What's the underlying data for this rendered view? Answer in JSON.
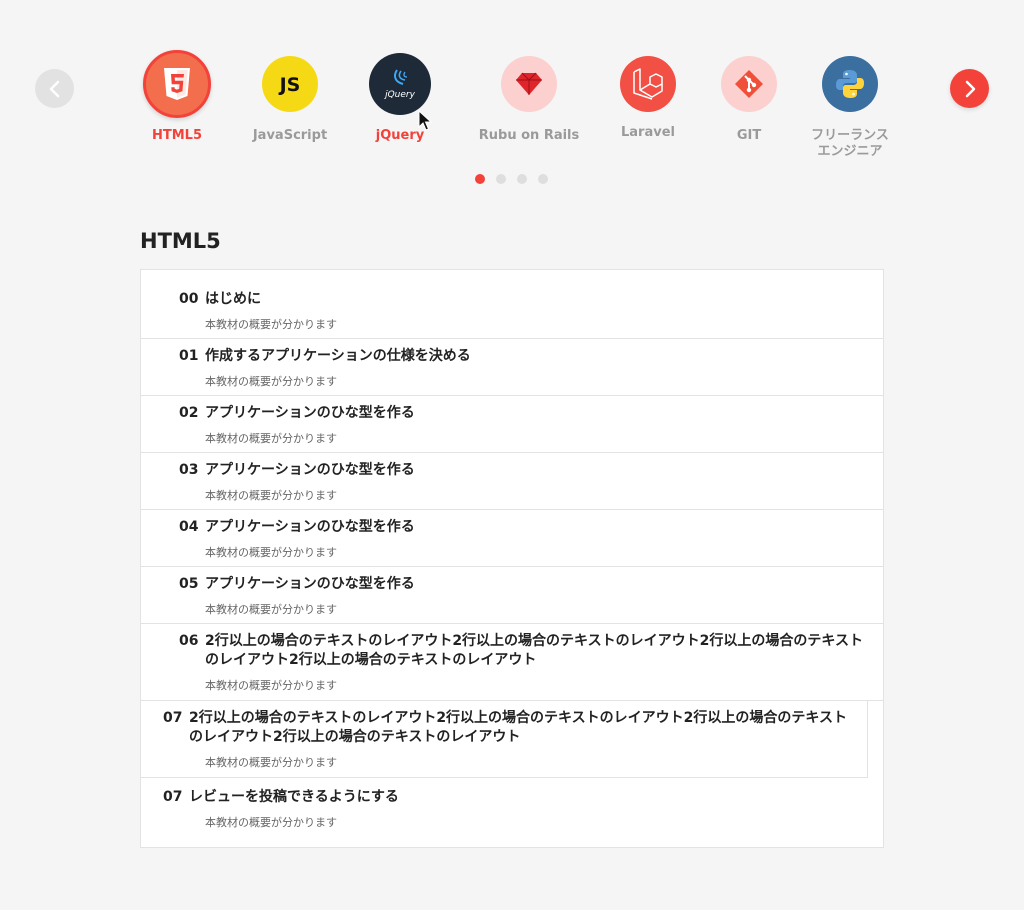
{
  "carousel": {
    "categories": [
      {
        "label": "HTML5",
        "icon": "html5-icon",
        "color": "#f26e4d"
      },
      {
        "label": "JavaScript",
        "icon": "js-icon",
        "color": "#f6d915"
      },
      {
        "label": "jQuery",
        "icon": "jquery-icon",
        "color": "#1e2a38"
      },
      {
        "label": "Rubu on Rails",
        "icon": "ruby-icon",
        "color": "#fbd0ce"
      },
      {
        "label": "Laravel",
        "icon": "laravel-icon",
        "color": "#f35045"
      },
      {
        "label": "GIT",
        "icon": "git-icon",
        "color": "#fbd0ce"
      },
      {
        "label": "フリーランス\nエンジニア",
        "icon": "python-icon",
        "color": "#3a6f9f"
      }
    ],
    "pages": 4,
    "current_page": 1,
    "accent": "#f2423a"
  },
  "section": {
    "title": "HTML5"
  },
  "lessons": [
    {
      "num": "00",
      "title": "はじめに",
      "desc": "本教材の概要が分かります"
    },
    {
      "num": "01",
      "title": "作成するアプリケーションの仕様を決める",
      "desc": "本教材の概要が分かります"
    },
    {
      "num": "02",
      "title": "アプリケーションのひな型を作る",
      "desc": "本教材の概要が分かります"
    },
    {
      "num": "03",
      "title": "アプリケーションのひな型を作る",
      "desc": "本教材の概要が分かります"
    },
    {
      "num": "04",
      "title": "アプリケーションのひな型を作る",
      "desc": "本教材の概要が分かります"
    },
    {
      "num": "05",
      "title": "アプリケーションのひな型を作る",
      "desc": "本教材の概要が分かります"
    },
    {
      "num": "06",
      "title": "2行以上の場合のテキストのレイアウト2行以上の場合のテキストのレイアウト2行以上の場合のテキストのレイアウト2行以上の場合のテキストのレイアウト",
      "desc": "本教材の概要が分かります"
    },
    {
      "num": "07",
      "title": "2行以上の場合のテキストのレイアウト2行以上の場合のテキストのレイアウト2行以上の場合のテキストのレイアウト2行以上の場合のテキストのレイアウト",
      "desc": "本教材の概要が分かります"
    },
    {
      "num": "07",
      "title": "レビューを投稿できるようにする",
      "desc": "本教材の概要が分かります"
    }
  ]
}
